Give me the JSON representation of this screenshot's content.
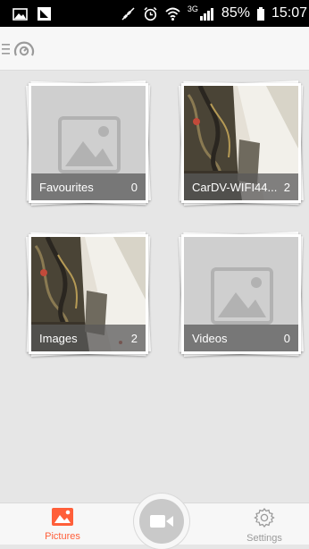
{
  "status_bar": {
    "battery": "85%",
    "time": "15:07",
    "network": "3G",
    "icons": [
      "image-notification-icon",
      "nfc-icon",
      "mute-icon",
      "alarm-icon",
      "wifi-icon",
      "signal-icon",
      "battery-icon"
    ]
  },
  "header": {
    "menu_icon": "hamburger-menu-icon",
    "logo_icon": "app-logo-icon"
  },
  "albums": [
    {
      "name": "Favourites",
      "count": "0",
      "thumbnail": "placeholder"
    },
    {
      "name": "CarDV-WIFI44...",
      "count": "2",
      "thumbnail": "photo"
    },
    {
      "name": "Images",
      "count": "2",
      "thumbnail": "photo"
    },
    {
      "name": "Videos",
      "count": "0",
      "thumbnail": "placeholder"
    }
  ],
  "bottom_nav": {
    "pictures_label": "Pictures",
    "settings_label": "Settings",
    "camera_icon": "video-camera-icon"
  },
  "colors": {
    "accent": "#ff5f3a",
    "background": "#e6e6e6",
    "caption_bg": "#5a5a5a"
  }
}
